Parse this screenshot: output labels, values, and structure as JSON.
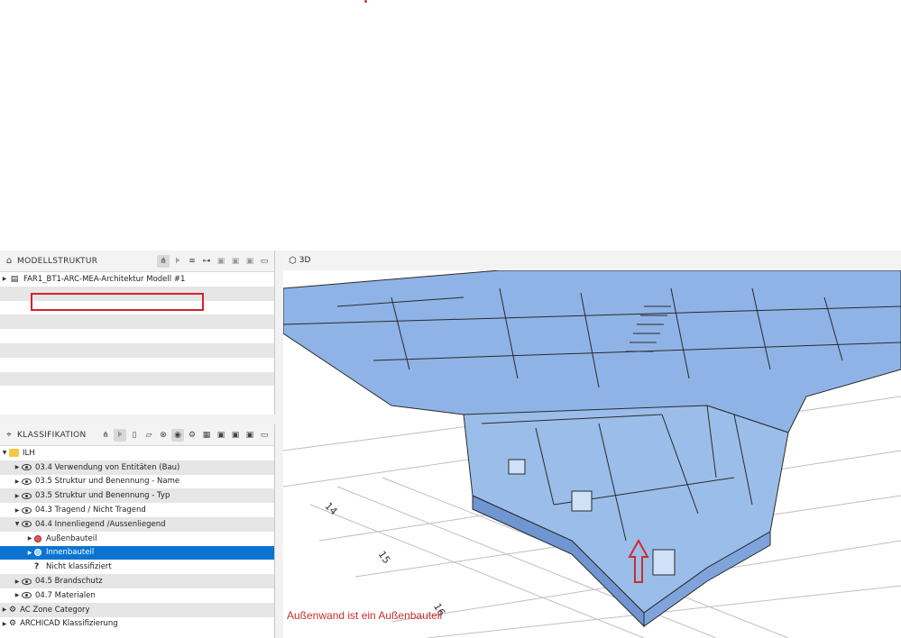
{
  "model_panel": {
    "title": "MODELLSTRUKTUR",
    "items": [
      {
        "label": "FAR1_BT1-ARC-MEA-Architektur Modell #1"
      }
    ]
  },
  "class_panel": {
    "title": "KLASSIFIKATION",
    "tree": [
      {
        "label": "ILH"
      },
      {
        "label": "03.4 Verwendung von Entitäten (Bau)"
      },
      {
        "label": "03.5 Struktur und Benennung - Name"
      },
      {
        "label": "03.5 Struktur und Benennung - Typ"
      },
      {
        "label": "04.3 Tragend / Nicht Tragend"
      },
      {
        "label": "04.4 Innenliegend /Aussenliegend"
      },
      {
        "label": "Außenbauteil"
      },
      {
        "label": "Innenbauteil"
      },
      {
        "label": "Nicht klassifiziert"
      },
      {
        "label": "04.5 Brandschutz"
      },
      {
        "label": "04.7 Materialen"
      },
      {
        "label": "AC Zone Category"
      },
      {
        "label": "ARCHICAD Klassifizierung"
      }
    ]
  },
  "view3d": {
    "title": "3D",
    "grid_labels": [
      "14",
      "15",
      "16"
    ],
    "annotation": "Außenwand ist ein Außenbauteil"
  },
  "colors": {
    "selection": "#0b74d1",
    "highlight_border": "#d2232a",
    "annotation": "#c9302c",
    "building": "#8fb3e6"
  },
  "icons": {
    "model": "building-icon",
    "classification": "tag-icon",
    "view": "cube-icon"
  }
}
